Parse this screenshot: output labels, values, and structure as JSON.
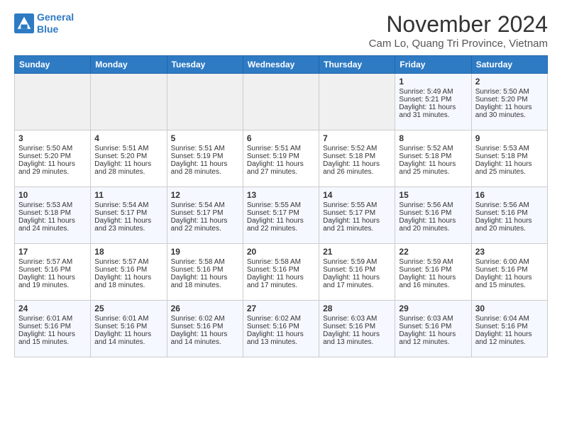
{
  "header": {
    "logo_line1": "General",
    "logo_line2": "Blue",
    "title": "November 2024",
    "subtitle": "Cam Lo, Quang Tri Province, Vietnam"
  },
  "weekdays": [
    "Sunday",
    "Monday",
    "Tuesday",
    "Wednesday",
    "Thursday",
    "Friday",
    "Saturday"
  ],
  "weeks": [
    [
      {
        "day": "",
        "empty": true
      },
      {
        "day": "",
        "empty": true
      },
      {
        "day": "",
        "empty": true
      },
      {
        "day": "",
        "empty": true
      },
      {
        "day": "",
        "empty": true
      },
      {
        "day": "1",
        "sunrise": "Sunrise: 5:49 AM",
        "sunset": "Sunset: 5:21 PM",
        "daylight": "Daylight: 11 hours and 31 minutes."
      },
      {
        "day": "2",
        "sunrise": "Sunrise: 5:50 AM",
        "sunset": "Sunset: 5:20 PM",
        "daylight": "Daylight: 11 hours and 30 minutes."
      }
    ],
    [
      {
        "day": "3",
        "sunrise": "Sunrise: 5:50 AM",
        "sunset": "Sunset: 5:20 PM",
        "daylight": "Daylight: 11 hours and 29 minutes."
      },
      {
        "day": "4",
        "sunrise": "Sunrise: 5:51 AM",
        "sunset": "Sunset: 5:20 PM",
        "daylight": "Daylight: 11 hours and 28 minutes."
      },
      {
        "day": "5",
        "sunrise": "Sunrise: 5:51 AM",
        "sunset": "Sunset: 5:19 PM",
        "daylight": "Daylight: 11 hours and 28 minutes."
      },
      {
        "day": "6",
        "sunrise": "Sunrise: 5:51 AM",
        "sunset": "Sunset: 5:19 PM",
        "daylight": "Daylight: 11 hours and 27 minutes."
      },
      {
        "day": "7",
        "sunrise": "Sunrise: 5:52 AM",
        "sunset": "Sunset: 5:18 PM",
        "daylight": "Daylight: 11 hours and 26 minutes."
      },
      {
        "day": "8",
        "sunrise": "Sunrise: 5:52 AM",
        "sunset": "Sunset: 5:18 PM",
        "daylight": "Daylight: 11 hours and 25 minutes."
      },
      {
        "day": "9",
        "sunrise": "Sunrise: 5:53 AM",
        "sunset": "Sunset: 5:18 PM",
        "daylight": "Daylight: 11 hours and 25 minutes."
      }
    ],
    [
      {
        "day": "10",
        "sunrise": "Sunrise: 5:53 AM",
        "sunset": "Sunset: 5:18 PM",
        "daylight": "Daylight: 11 hours and 24 minutes."
      },
      {
        "day": "11",
        "sunrise": "Sunrise: 5:54 AM",
        "sunset": "Sunset: 5:17 PM",
        "daylight": "Daylight: 11 hours and 23 minutes."
      },
      {
        "day": "12",
        "sunrise": "Sunrise: 5:54 AM",
        "sunset": "Sunset: 5:17 PM",
        "daylight": "Daylight: 11 hours and 22 minutes."
      },
      {
        "day": "13",
        "sunrise": "Sunrise: 5:55 AM",
        "sunset": "Sunset: 5:17 PM",
        "daylight": "Daylight: 11 hours and 22 minutes."
      },
      {
        "day": "14",
        "sunrise": "Sunrise: 5:55 AM",
        "sunset": "Sunset: 5:17 PM",
        "daylight": "Daylight: 11 hours and 21 minutes."
      },
      {
        "day": "15",
        "sunrise": "Sunrise: 5:56 AM",
        "sunset": "Sunset: 5:16 PM",
        "daylight": "Daylight: 11 hours and 20 minutes."
      },
      {
        "day": "16",
        "sunrise": "Sunrise: 5:56 AM",
        "sunset": "Sunset: 5:16 PM",
        "daylight": "Daylight: 11 hours and 20 minutes."
      }
    ],
    [
      {
        "day": "17",
        "sunrise": "Sunrise: 5:57 AM",
        "sunset": "Sunset: 5:16 PM",
        "daylight": "Daylight: 11 hours and 19 minutes."
      },
      {
        "day": "18",
        "sunrise": "Sunrise: 5:57 AM",
        "sunset": "Sunset: 5:16 PM",
        "daylight": "Daylight: 11 hours and 18 minutes."
      },
      {
        "day": "19",
        "sunrise": "Sunrise: 5:58 AM",
        "sunset": "Sunset: 5:16 PM",
        "daylight": "Daylight: 11 hours and 18 minutes."
      },
      {
        "day": "20",
        "sunrise": "Sunrise: 5:58 AM",
        "sunset": "Sunset: 5:16 PM",
        "daylight": "Daylight: 11 hours and 17 minutes."
      },
      {
        "day": "21",
        "sunrise": "Sunrise: 5:59 AM",
        "sunset": "Sunset: 5:16 PM",
        "daylight": "Daylight: 11 hours and 17 minutes."
      },
      {
        "day": "22",
        "sunrise": "Sunrise: 5:59 AM",
        "sunset": "Sunset: 5:16 PM",
        "daylight": "Daylight: 11 hours and 16 minutes."
      },
      {
        "day": "23",
        "sunrise": "Sunrise: 6:00 AM",
        "sunset": "Sunset: 5:16 PM",
        "daylight": "Daylight: 11 hours and 15 minutes."
      }
    ],
    [
      {
        "day": "24",
        "sunrise": "Sunrise: 6:01 AM",
        "sunset": "Sunset: 5:16 PM",
        "daylight": "Daylight: 11 hours and 15 minutes."
      },
      {
        "day": "25",
        "sunrise": "Sunrise: 6:01 AM",
        "sunset": "Sunset: 5:16 PM",
        "daylight": "Daylight: 11 hours and 14 minutes."
      },
      {
        "day": "26",
        "sunrise": "Sunrise: 6:02 AM",
        "sunset": "Sunset: 5:16 PM",
        "daylight": "Daylight: 11 hours and 14 minutes."
      },
      {
        "day": "27",
        "sunrise": "Sunrise: 6:02 AM",
        "sunset": "Sunset: 5:16 PM",
        "daylight": "Daylight: 11 hours and 13 minutes."
      },
      {
        "day": "28",
        "sunrise": "Sunrise: 6:03 AM",
        "sunset": "Sunset: 5:16 PM",
        "daylight": "Daylight: 11 hours and 13 minutes."
      },
      {
        "day": "29",
        "sunrise": "Sunrise: 6:03 AM",
        "sunset": "Sunset: 5:16 PM",
        "daylight": "Daylight: 11 hours and 12 minutes."
      },
      {
        "day": "30",
        "sunrise": "Sunrise: 6:04 AM",
        "sunset": "Sunset: 5:16 PM",
        "daylight": "Daylight: 11 hours and 12 minutes."
      }
    ]
  ]
}
